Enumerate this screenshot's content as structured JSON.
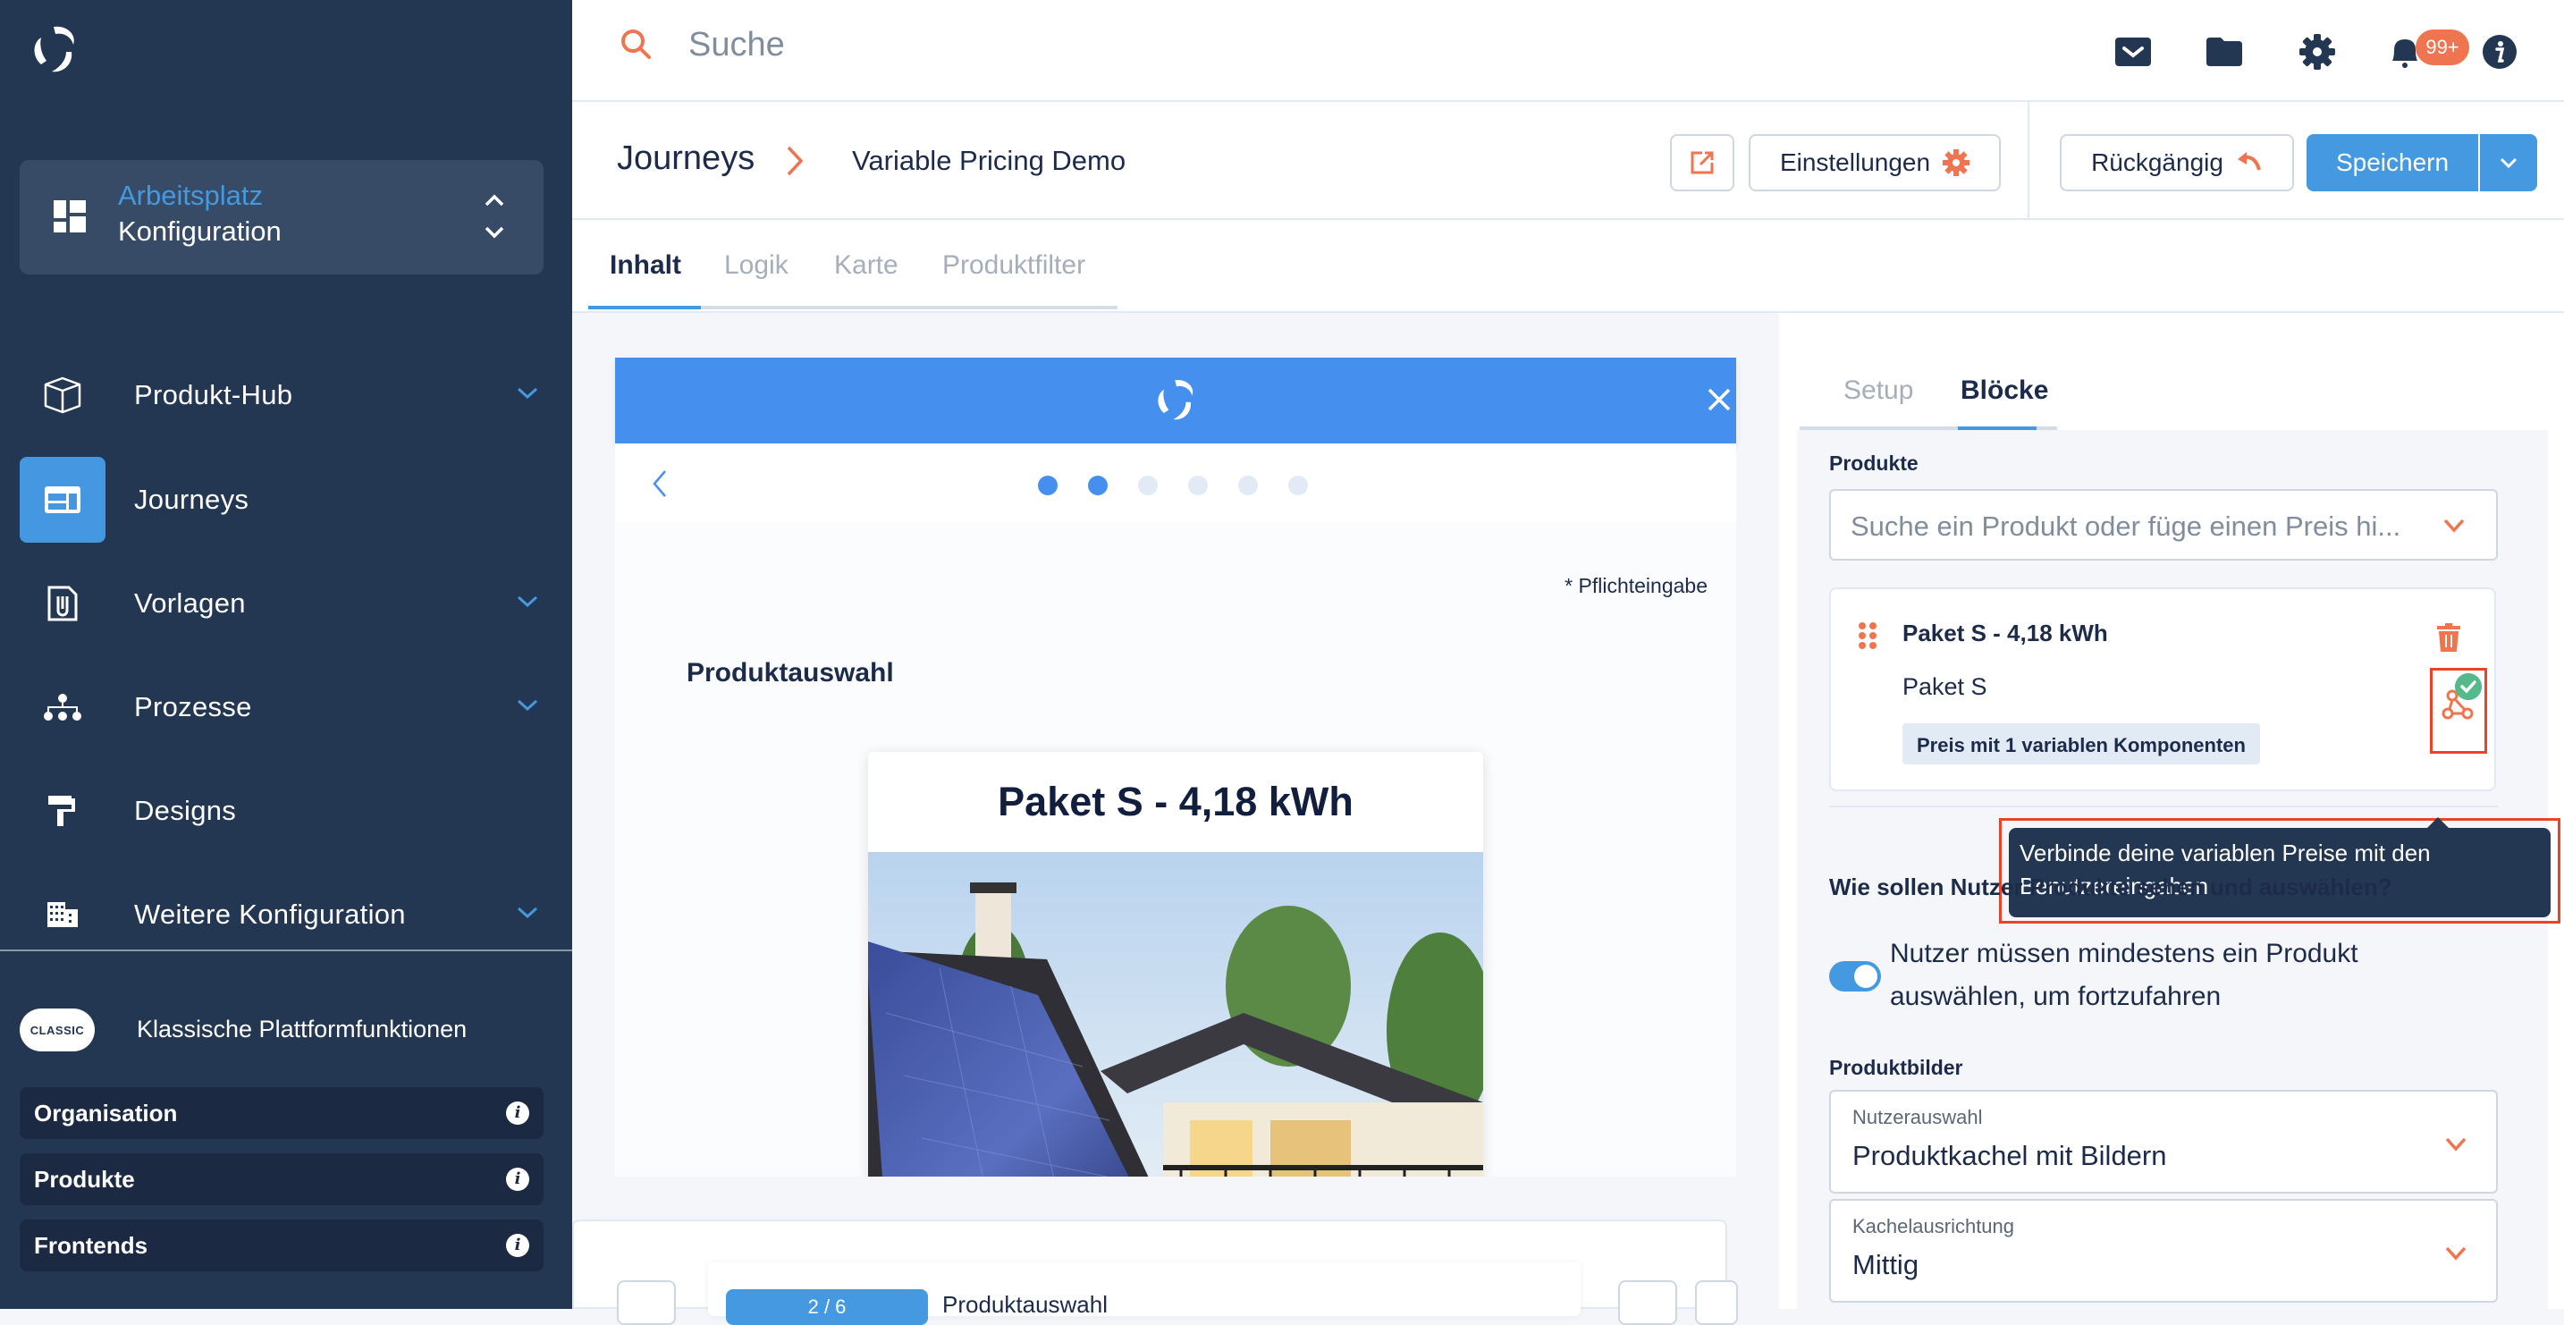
{
  "sidebar": {
    "logo": "brand-logo",
    "workspace": {
      "title": "Arbeitsplatz",
      "subtitle": "Konfiguration"
    },
    "nav": [
      {
        "label": "Produkt-Hub",
        "icon": "cube-icon",
        "expandable": true,
        "active": false
      },
      {
        "label": "Journeys",
        "icon": "journey-window-icon",
        "expandable": false,
        "active": true
      },
      {
        "label": "Vorlagen",
        "icon": "file-attachment-icon",
        "expandable": true,
        "active": false
      },
      {
        "label": "Prozesse",
        "icon": "hierarchy-icon",
        "expandable": true,
        "active": false
      },
      {
        "label": "Designs",
        "icon": "paint-roller-icon",
        "expandable": false,
        "active": false
      },
      {
        "label": "Weitere Konfiguration",
        "icon": "building-icon",
        "expandable": true,
        "active": false
      }
    ],
    "classic": {
      "badge": "CLASSIC",
      "title": "Klassische Plattformfunktionen",
      "items": [
        {
          "label": "Organisation",
          "icon": "info-icon"
        },
        {
          "label": "Produkte",
          "icon": "info-icon"
        },
        {
          "label": "Frontends",
          "icon": "info-icon"
        }
      ]
    }
  },
  "topbar": {
    "search_placeholder": "Suche",
    "icons": [
      "mail-icon",
      "folder-icon",
      "gear-icon",
      "bell-icon",
      "info-icon"
    ],
    "notification_count": "99+"
  },
  "breadcrumb": {
    "root": "Journeys",
    "current": "Variable Pricing Demo"
  },
  "toolbar": {
    "open_external_icon": "external-link-icon",
    "settings_label": "Einstellungen",
    "undo_label": "Rückgängig",
    "save_label": "Speichern"
  },
  "main_tabs": [
    {
      "label": "Inhalt",
      "active": true
    },
    {
      "label": "Logik",
      "active": false
    },
    {
      "label": "Karte",
      "active": false
    },
    {
      "label": "Produktfilter",
      "active": false
    }
  ],
  "preview": {
    "steps_total": 6,
    "steps_done": 2,
    "required_note": "* Pflichteingabe",
    "section_title": "Produktauswahl",
    "product_tile_title": "Paket S - 4,18 kWh",
    "product_image": "solar-house-photo"
  },
  "footer": {
    "step_badge": "2 / 6",
    "step_label": "Produktauswahl"
  },
  "side_tabs": [
    {
      "label": "Setup",
      "active": false
    },
    {
      "label": "Blöcke",
      "active": true
    }
  ],
  "blocks": {
    "products_label": "Produkte",
    "product_search_placeholder": "Suche ein Produkt oder füge einen Preis hi...",
    "product_card": {
      "title": "Paket S - 4,18 kWh",
      "subtitle": "Paket S",
      "price_badge": "Preis mit 1 variablen Komponenten"
    },
    "tooltip": "Verbinde deine variablen Preise mit den Benutzereingaben",
    "question": "Wie sollen Nutzer Produkte sehen und auswählen?",
    "require_toggle": {
      "label": "Nutzer müssen mindestens ein Produkt auswählen, um fortzufahren",
      "on": true
    },
    "images_label": "Produktbilder",
    "user_selection": {
      "label": "Nutzerauswahl",
      "value": "Produktkachel mit Bildern"
    },
    "tile_alignment": {
      "label": "Kachelausrichtung",
      "value": "Mittig"
    }
  },
  "colors": {
    "sidebar_bg": "#233752",
    "accent_blue": "#4499e0",
    "accent_orange": "#ef7550",
    "highlight_red": "#ea4325",
    "success_green": "#55b98a"
  }
}
